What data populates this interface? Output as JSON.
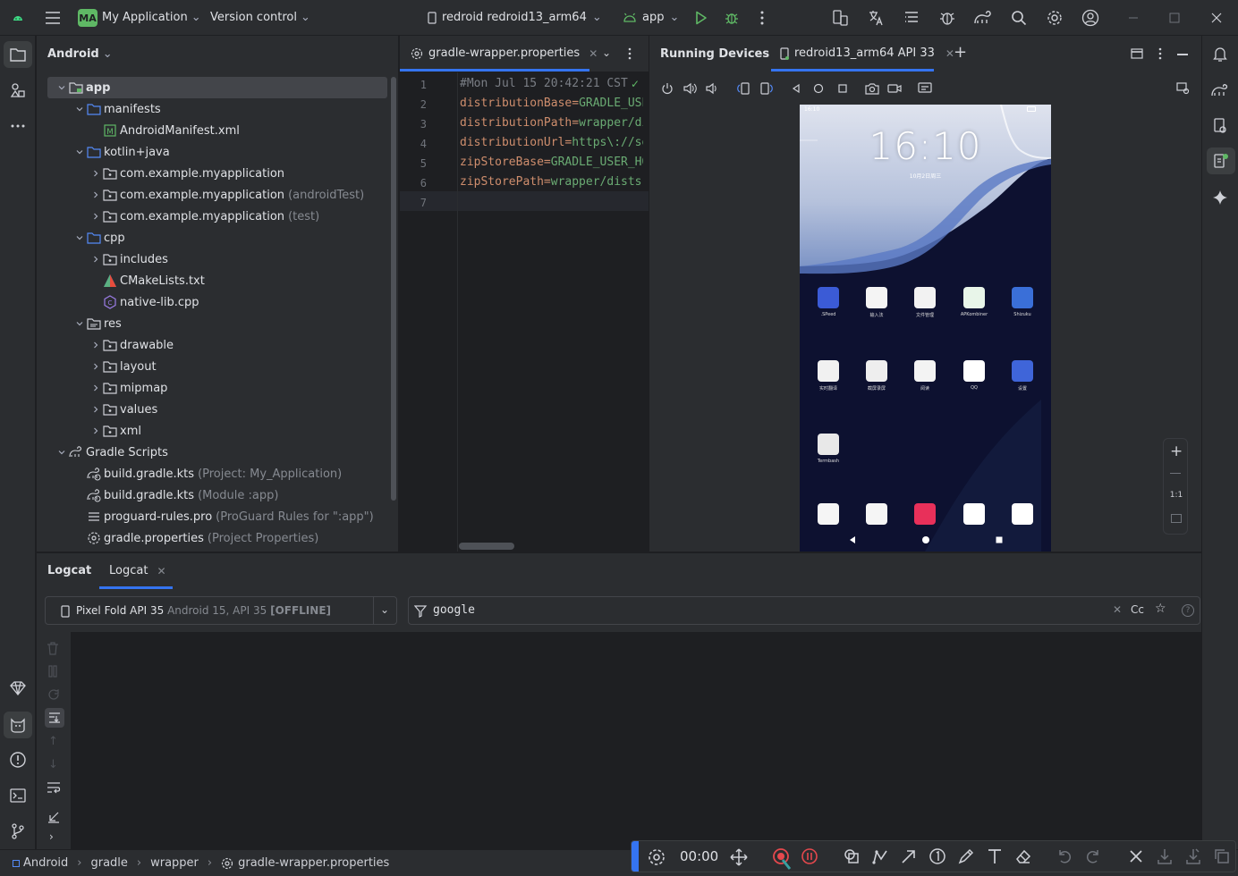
{
  "titlebar": {
    "project_badge": "MA",
    "project_name": "My Application",
    "vcs": "Version control",
    "device": "redroid redroid13_arm64",
    "run_config": "app"
  },
  "project_panel": {
    "view": "Android",
    "tree": [
      {
        "label": "app",
        "secondary": ""
      },
      {
        "label": "manifests",
        "secondary": ""
      },
      {
        "label": "AndroidManifest.xml",
        "secondary": ""
      },
      {
        "label": "kotlin+java",
        "secondary": ""
      },
      {
        "label": "com.example.myapplication",
        "secondary": ""
      },
      {
        "label": "com.example.myapplication",
        "secondary": "(androidTest)"
      },
      {
        "label": "com.example.myapplication",
        "secondary": "(test)"
      },
      {
        "label": "cpp",
        "secondary": ""
      },
      {
        "label": "includes",
        "secondary": ""
      },
      {
        "label": "CMakeLists.txt",
        "secondary": ""
      },
      {
        "label": "native-lib.cpp",
        "secondary": ""
      },
      {
        "label": "res",
        "secondary": ""
      },
      {
        "label": "drawable",
        "secondary": ""
      },
      {
        "label": "layout",
        "secondary": ""
      },
      {
        "label": "mipmap",
        "secondary": ""
      },
      {
        "label": "values",
        "secondary": ""
      },
      {
        "label": "xml",
        "secondary": ""
      },
      {
        "label": "Gradle Scripts",
        "secondary": ""
      },
      {
        "label": "build.gradle.kts",
        "secondary": "(Project: My_Application)"
      },
      {
        "label": "build.gradle.kts",
        "secondary": "(Module :app)"
      },
      {
        "label": "proguard-rules.pro",
        "secondary": "(ProGuard Rules for \":app\")"
      },
      {
        "label": "gradle.properties",
        "secondary": "(Project Properties)"
      }
    ]
  },
  "editor": {
    "tab": "gradle-wrapper.properties",
    "lines": [
      {
        "num": "1",
        "text": "#Mon Jul 15 20:42:21 CST"
      },
      {
        "num": "2",
        "key": "distributionBase",
        "value": "GRADLE_USER_HOME"
      },
      {
        "num": "3",
        "key": "distributionPath",
        "value": "wrapper/dists"
      },
      {
        "num": "4",
        "key": "distributionUrl",
        "value": "https\\://services.gradle.org"
      },
      {
        "num": "5",
        "key": "zipStoreBase",
        "value": "GRADLE_USER_HOME"
      },
      {
        "num": "6",
        "key": "zipStorePath",
        "value": "wrapper/dists"
      },
      {
        "num": "7",
        "text": ""
      }
    ]
  },
  "running_devices": {
    "title": "Running Devices",
    "tab": "redroid13_arm64 API 33",
    "zoom_label": "1:1",
    "phone": {
      "status_time": "16:10",
      "clock": "16:10",
      "date": "10月2日周三",
      "apps": [
        {
          "label": ".SPeed",
          "color": "#3b5bd6"
        },
        {
          "label": "输入法",
          "color": "#f4f4f4"
        },
        {
          "label": "文件管理",
          "color": "#f2f2f2"
        },
        {
          "label": "APKombiner",
          "color": "#e8f5e9"
        },
        {
          "label": "Shizuku",
          "color": "#3a6fd8"
        },
        {
          "label": "实时翻译",
          "color": "#f1f1f1"
        },
        {
          "label": "截屏录屏",
          "color": "#eeeeee"
        },
        {
          "label": "阅读",
          "color": "#f3f3f3"
        },
        {
          "label": "QQ",
          "color": "#ffffff"
        },
        {
          "label": "设置",
          "color": "#3f65d9"
        },
        {
          "label": "Termbash",
          "color": "#e8e8e8"
        }
      ],
      "dock_colors": [
        "#f5f5f5",
        "#f5f5f5",
        "#e8305a",
        "#ffffff",
        "#ffffff"
      ]
    }
  },
  "logcat": {
    "tabs": [
      "Logcat",
      "Logcat"
    ],
    "device_name": "Pixel Fold API 35",
    "device_detail": "Android 15, API 35",
    "device_state": "[OFFLINE]",
    "filter": "google",
    "case_label": "Cc"
  },
  "status": {
    "crumbs": [
      "Android",
      "gradle",
      "wrapper",
      "gradle-wrapper.properties"
    ]
  },
  "recorder": {
    "time": "00:00"
  },
  "colors": {
    "accent": "#3574f0",
    "run_green": "#5fb865",
    "record_red": "#e5484d",
    "key_orange": "#cf8e6d",
    "value_green": "#6aab73"
  }
}
